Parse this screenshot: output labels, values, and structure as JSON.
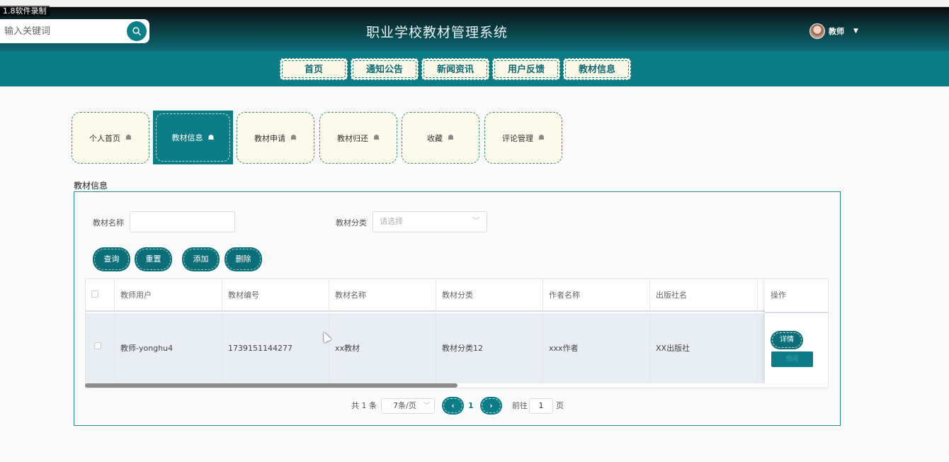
{
  "overlay": {
    "recorder_label": "1.8软件录制"
  },
  "header": {
    "search_placeholder": "输入关键词",
    "site_title": "职业学校教材管理系统",
    "user_name": "教师"
  },
  "nav": [
    "首页",
    "通知公告",
    "新闻资讯",
    "用户反馈",
    "教材信息"
  ],
  "cards": [
    {
      "label": "个人首页",
      "active": false
    },
    {
      "label": "教材信息",
      "active": true
    },
    {
      "label": "教材申请",
      "active": false
    },
    {
      "label": "教材归还",
      "active": false
    },
    {
      "label": "收藏",
      "active": false
    },
    {
      "label": "评论管理",
      "active": false
    }
  ],
  "section_title": "教材信息",
  "filters": {
    "name_label": "教材名称",
    "name_value": "",
    "category_label": "教材分类",
    "category_placeholder": "请选择"
  },
  "actions": {
    "query": "查询",
    "reset": "重置",
    "add": "添加",
    "delete": "删除"
  },
  "table": {
    "columns": [
      "教师用户",
      "教材编号",
      "教材名称",
      "教材分类",
      "作者名称",
      "出版社名"
    ],
    "op_header": "操作",
    "rows": [
      {
        "cells": [
          "教师-yonghu4",
          "1739151144277",
          "xx教材",
          "教材分类12",
          "xxx作者",
          "XX出版社"
        ],
        "detail_btn": "详情",
        "ghost_btn": "借阅"
      }
    ]
  },
  "pagination": {
    "total": "共 1 条",
    "page_size": "7条/页",
    "current_page": "1",
    "goto_label": "前往",
    "goto_value": "1",
    "page_unit": "页"
  },
  "colors": {
    "brand": "#0c7c86",
    "card_bg": "#fbf9ea",
    "row_bg": "#e9eef5"
  }
}
